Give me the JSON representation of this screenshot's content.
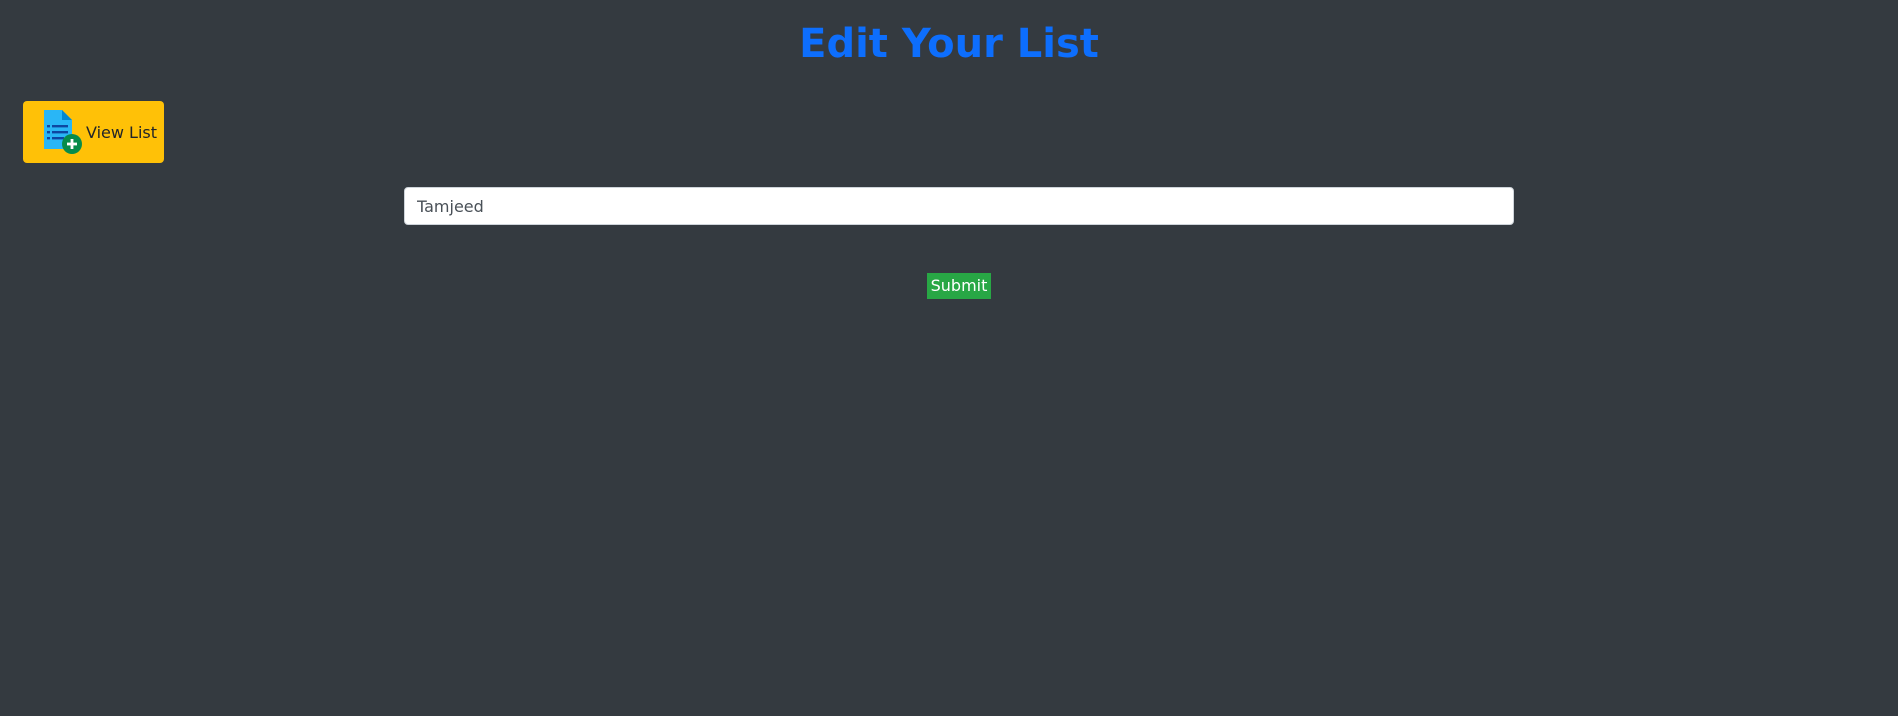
{
  "page": {
    "title": "Edit Your List",
    "background_color": "#343a40",
    "title_color": "#0d6efd"
  },
  "nav": {
    "view_list_label": "View List",
    "view_list_icon": "list-add-icon",
    "view_list_color": "#ffc107"
  },
  "form": {
    "name_value": "Tamjeed",
    "submit_label": "Submit",
    "submit_color": "#28a745"
  }
}
